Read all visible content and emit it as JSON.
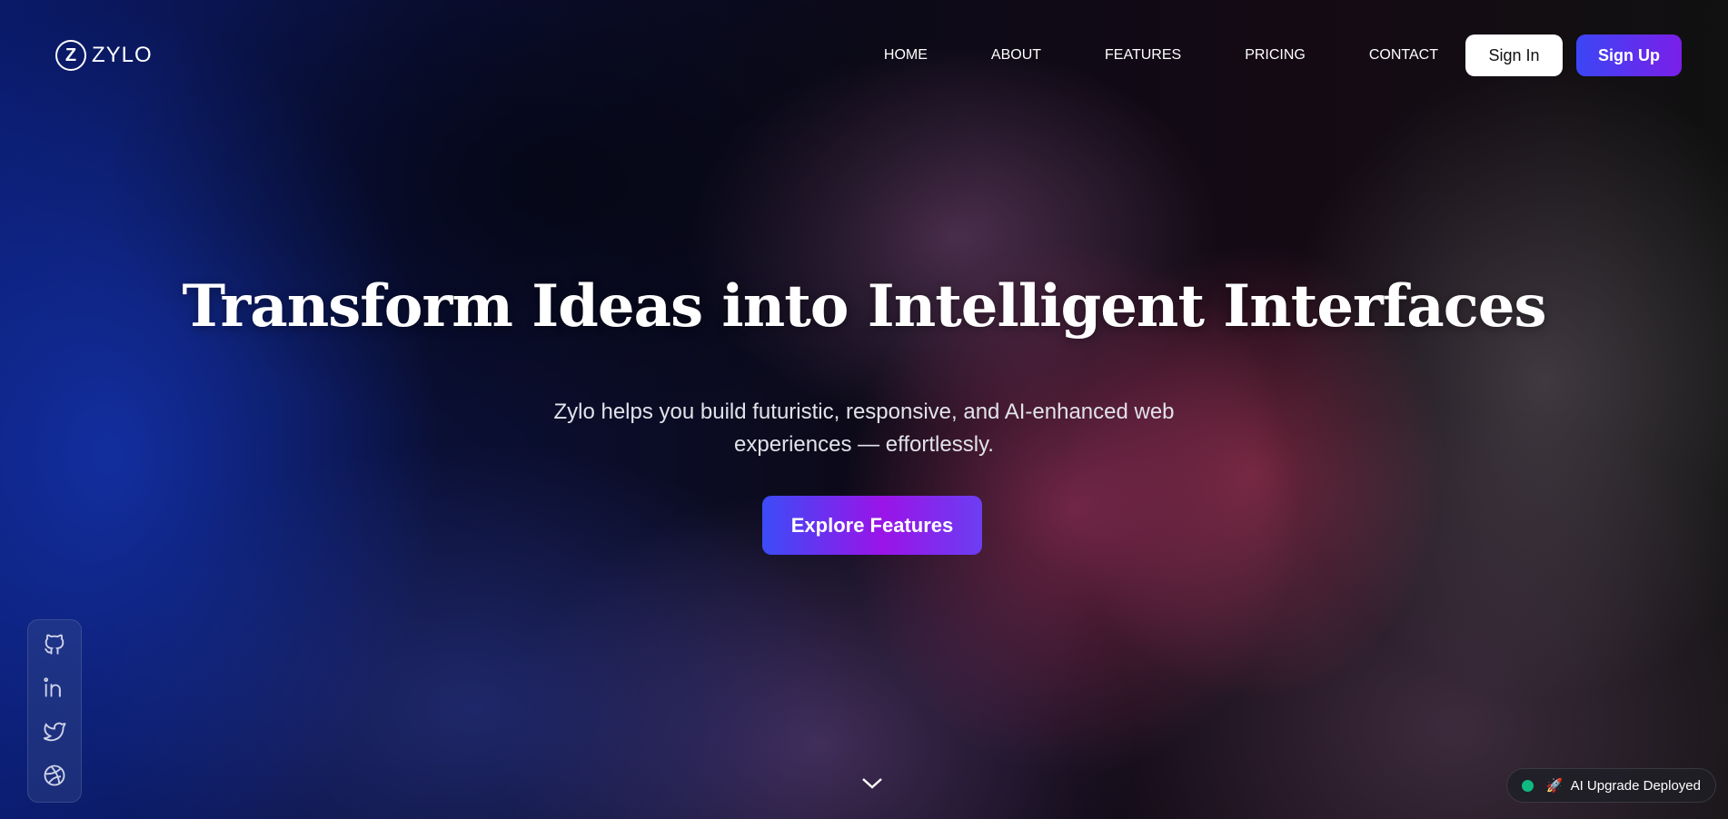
{
  "brand": {
    "logo_mark": "Z",
    "name": "ZYLO"
  },
  "nav": {
    "items": [
      {
        "label": "HOME"
      },
      {
        "label": "ABOUT"
      },
      {
        "label": "FEATURES"
      },
      {
        "label": "PRICING"
      },
      {
        "label": "CONTACT"
      }
    ],
    "sign_in_label": "Sign In",
    "sign_up_label": "Sign Up"
  },
  "hero": {
    "title": "Transform Ideas into Intelligent Interfaces",
    "subtitle": "Zylo helps you build futuristic, responsive, and AI-enhanced web experiences — effortlessly.",
    "cta_label": "Explore Features"
  },
  "social": {
    "icons": [
      "github-icon",
      "linkedin-icon",
      "twitter-icon",
      "dribbble-icon"
    ]
  },
  "toast": {
    "emoji": "🚀",
    "text": "AI Upgrade Deployed",
    "status_color": "#10b981"
  },
  "colors": {
    "accent_start": "#3b46f5",
    "accent_end": "#7a1fe8"
  }
}
